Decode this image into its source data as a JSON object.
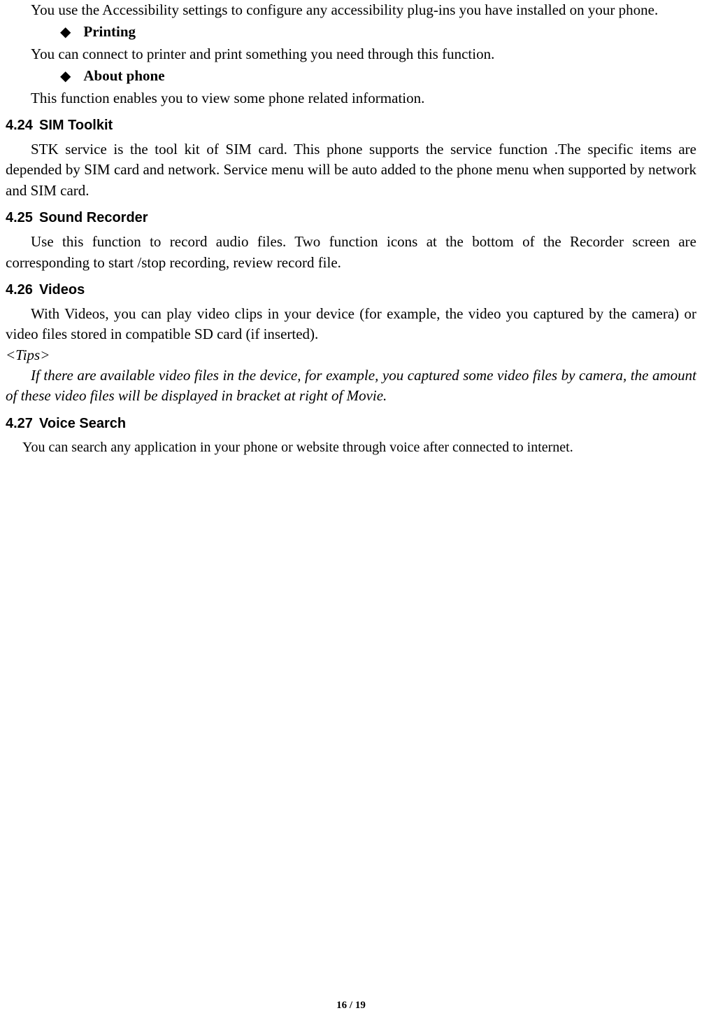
{
  "accessibility_desc": "You use the Accessibility settings to configure any accessibility plug-ins you have installed on your phone.",
  "bullet_printing": "Printing",
  "printing_desc": "You can connect to printer and print something you need through this function.",
  "bullet_about": "About phone",
  "about_desc": "This function enables you to view some phone related information.",
  "sec_424_num": "4.24",
  "sec_424_title": "SIM Toolkit",
  "sec_424_body": "STK service is the tool kit of SIM card. This phone supports the service function .The specific items are depended by SIM card and network. Service menu will be auto added to the phone menu when supported by network and SIM card.",
  "sec_425_num": "4.25",
  "sec_425_title": "Sound Recorder",
  "sec_425_body": "Use this function to record audio files. Two function icons at the bottom of the Recorder screen are corresponding to start /stop recording, review record file.",
  "sec_426_num": "4.26",
  "sec_426_title": "Videos",
  "sec_426_body": "With Videos, you can play video clips in your device (for example, the video you captured by the camera) or video files stored in compatible SD card (if inserted).",
  "tips_label": "<Tips>",
  "tips_body": "If there are available video files in the device, for example, you captured some video files by camera, the amount of these video files will be displayed in bracket at right of Movie.",
  "sec_427_num": "4.27",
  "sec_427_title": "Voice Search",
  "sec_427_body": "You can search any application in your phone or website through voice after connected to internet.",
  "page_current": "16",
  "page_sep": " / ",
  "page_total": "19"
}
